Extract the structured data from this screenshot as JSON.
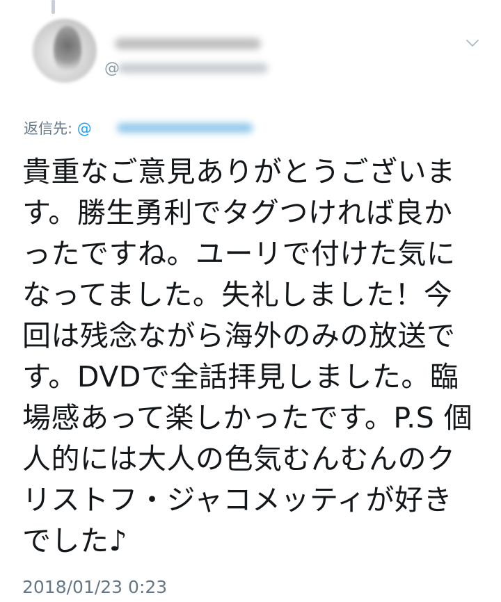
{
  "tweet": {
    "display_name": "",
    "handle": "@",
    "reply_label": "返信先: ",
    "reply_handle": "@",
    "text_lines": [
      "貴重なご意見ありがとうございま",
      "す。勝生勇利でタグつければ良か",
      "ったですね。ユーリで付けた気に",
      "なってました。失礼しました！今",
      "回は残念ながら海外のみの放送で",
      "す。DVDで全話拝見しました。臨",
      "場感あって楽しかったです。P.S 個",
      "人的には大人の色気むんむんのク",
      "リストフ・ジャコメッティが好き",
      "でした♪"
    ],
    "timestamp": "2018/01/23 0:23"
  },
  "icons": {
    "menu": "chevron-down-icon",
    "avatar": "avatar"
  },
  "colors": {
    "text": "#14171a",
    "secondary": "#657786",
    "link": "#1da1f2"
  }
}
